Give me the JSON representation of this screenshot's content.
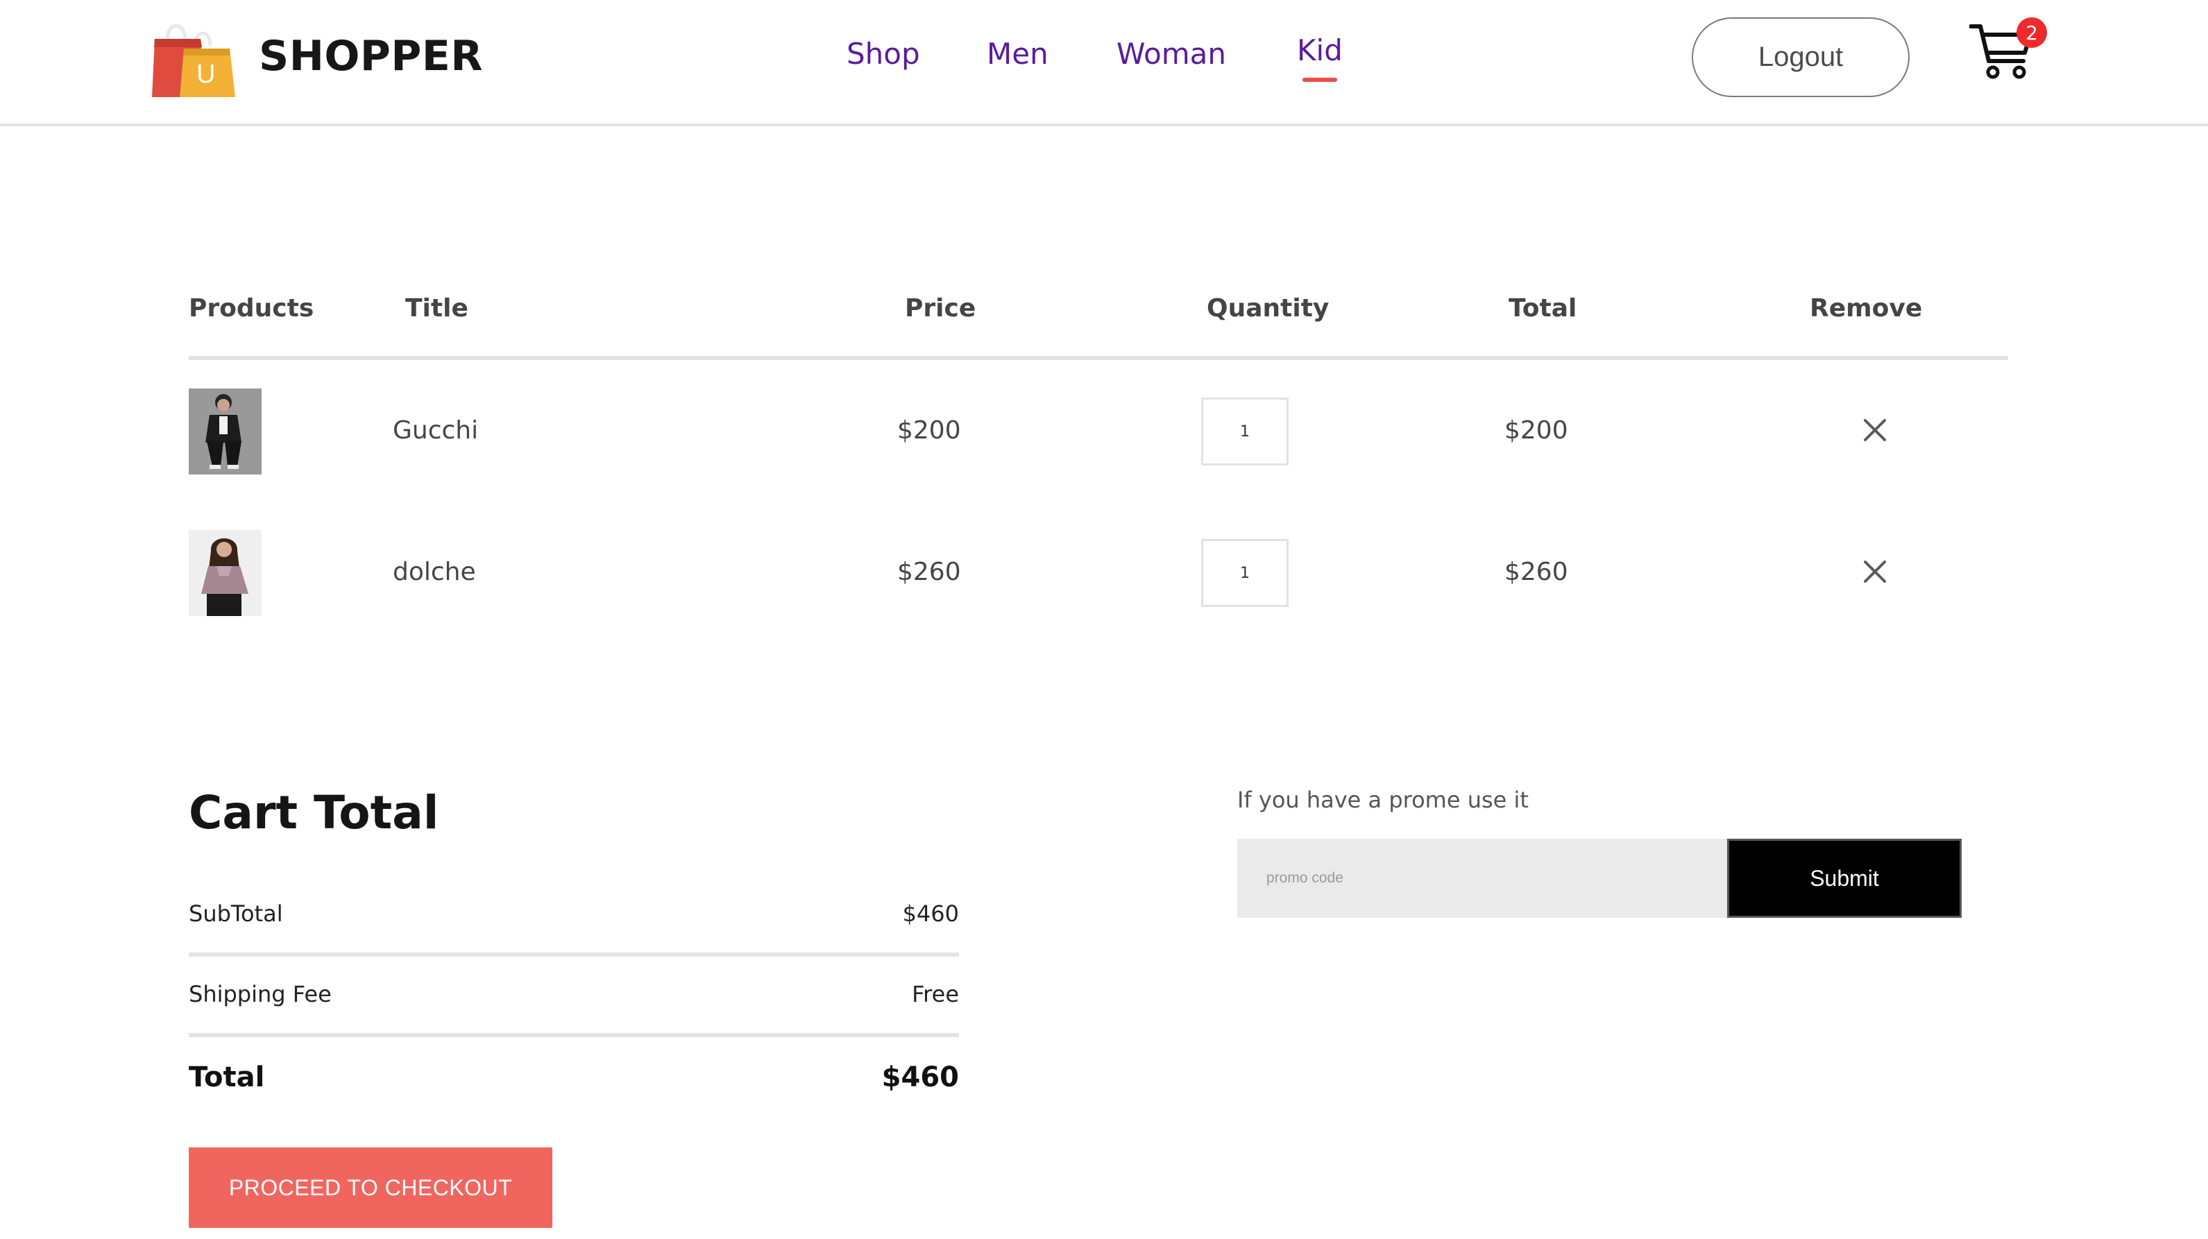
{
  "header": {
    "brand": "SHOPPER",
    "logo_letter": "U",
    "nav": [
      {
        "label": "Shop"
      },
      {
        "label": "Men"
      },
      {
        "label": "Woman"
      },
      {
        "label": "Kid",
        "active": true
      }
    ],
    "logout_label": "Logout",
    "cart_count": "2"
  },
  "cart": {
    "columns": {
      "products": "Products",
      "title": "Title",
      "price": "Price",
      "quantity": "Quantity",
      "total": "Total",
      "remove": "Remove"
    },
    "items": [
      {
        "title": "Gucchi",
        "price": "$200",
        "quantity": "1",
        "total": "$200"
      },
      {
        "title": "dolche",
        "price": "$260",
        "quantity": "1",
        "total": "$260"
      }
    ]
  },
  "summary": {
    "heading": "Cart Total",
    "subtotal_label": "SubTotal",
    "subtotal_value": "$460",
    "shipping_label": "Shipping Fee",
    "shipping_value": "Free",
    "total_label": "Total",
    "total_value": "$460",
    "checkout_label": "PROCEED TO CHECKOUT"
  },
  "promo": {
    "label": "If you have a prome use it",
    "placeholder": "promo code",
    "submit_label": "Submit"
  },
  "colors": {
    "nav_text": "#5a1b9c",
    "active_underline": "#ef4b4b",
    "badge": "#ef2a2a",
    "checkout_button": "#f0665f",
    "submit_button": "#000000",
    "promo_input_bg": "#eaeaea"
  },
  "icons": {
    "logo": "shopping-bag-icon",
    "cart": "shopping-cart-icon",
    "remove": "close-icon"
  }
}
